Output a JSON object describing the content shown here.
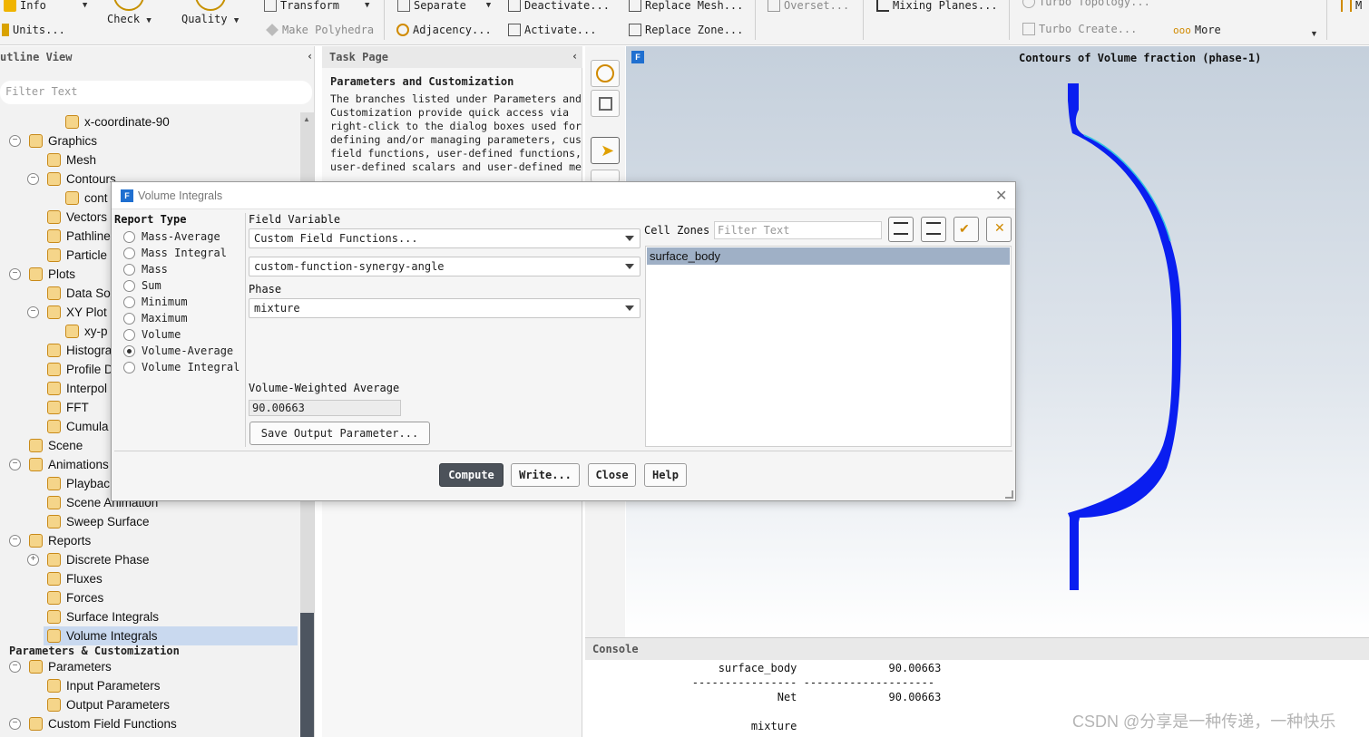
{
  "ribbon": {
    "info": "Info",
    "units": "Units...",
    "check": "Check",
    "quality": "Quality",
    "transform": "Transform",
    "make_polyhedra": "Make Polyhedra",
    "separate": "Separate",
    "adjacency": "Adjacency...",
    "deactivate": "Deactivate...",
    "activate": "Activate...",
    "replace_mesh": "Replace Mesh...",
    "replace_zone": "Replace Zone...",
    "overset": "Overset...",
    "mixing_planes": "Mixing Planes...",
    "turbo_topology": "Turbo Topology...",
    "turbo_create": "Turbo Create...",
    "more": "More",
    "far_right": "M"
  },
  "outline": {
    "title": "utline View",
    "filter_placeholder": "Filter Text",
    "tree": [
      {
        "label": "x-coordinate-90",
        "level": 3,
        "toggle": ""
      },
      {
        "label": "Graphics",
        "level": 1,
        "toggle": "−"
      },
      {
        "label": "Mesh",
        "level": 2,
        "toggle": ""
      },
      {
        "label": "Contours",
        "level": 2,
        "toggle": "−"
      },
      {
        "label": "cont",
        "level": 3,
        "toggle": ""
      },
      {
        "label": "Vectors",
        "level": 2,
        "toggle": ""
      },
      {
        "label": "Pathline",
        "level": 2,
        "toggle": ""
      },
      {
        "label": "Particle",
        "level": 2,
        "toggle": ""
      },
      {
        "label": "Plots",
        "level": 1,
        "toggle": "−"
      },
      {
        "label": "Data So",
        "level": 2,
        "toggle": ""
      },
      {
        "label": "XY Plot",
        "level": 2,
        "toggle": "−"
      },
      {
        "label": "xy-p",
        "level": 3,
        "toggle": ""
      },
      {
        "label": "Histogra",
        "level": 2,
        "toggle": ""
      },
      {
        "label": "Profile D",
        "level": 2,
        "toggle": ""
      },
      {
        "label": "Interpol",
        "level": 2,
        "toggle": ""
      },
      {
        "label": "FFT",
        "level": 2,
        "toggle": ""
      },
      {
        "label": "Cumula",
        "level": 2,
        "toggle": ""
      },
      {
        "label": "Scene",
        "level": 1,
        "toggle": ""
      },
      {
        "label": "Animations",
        "level": 1,
        "toggle": "−"
      },
      {
        "label": "Playbac",
        "level": 2,
        "toggle": ""
      },
      {
        "label": "Scene Animation",
        "level": 2,
        "toggle": ""
      },
      {
        "label": "Sweep Surface",
        "level": 2,
        "toggle": ""
      },
      {
        "label": "Reports",
        "level": 1,
        "toggle": "−"
      },
      {
        "label": "Discrete Phase",
        "level": 2,
        "toggle": "+"
      },
      {
        "label": "Fluxes",
        "level": 2,
        "toggle": ""
      },
      {
        "label": "Forces",
        "level": 2,
        "toggle": ""
      },
      {
        "label": "Surface Integrals",
        "level": 2,
        "toggle": ""
      },
      {
        "label": "Volume Integrals",
        "level": 2,
        "toggle": "",
        "selected": true
      }
    ],
    "section2_title": "Parameters & Customization",
    "tree2": [
      {
        "label": "Parameters",
        "level": 1,
        "toggle": "−"
      },
      {
        "label": "Input Parameters",
        "level": 2,
        "toggle": ""
      },
      {
        "label": "Output Parameters",
        "level": 2,
        "toggle": ""
      },
      {
        "label": "Custom Field Functions",
        "level": 1,
        "toggle": "−"
      }
    ]
  },
  "taskpage": {
    "title": "Task Page",
    "heading": "Parameters and Customization",
    "description_lines": [
      "The branches listed under Parameters and",
      "Customization provide quick access via",
      "right-click to the dialog boxes used for",
      "defining and/or managing parameters, cus",
      "field functions, user-defined functions,",
      "user-defined scalars and user-defined me"
    ]
  },
  "graphics": {
    "title": "Contours of Volume fraction (phase-1)",
    "badge": "F",
    "accent_blue": "#0a1ef0"
  },
  "console": {
    "title": "Console",
    "lines": [
      "            surface_body              90.00663",
      "        ---------------- --------------------",
      "                     Net              90.00663",
      "",
      "                 mixture"
    ]
  },
  "watermark": "CSDN @分享是一种传递，一种快乐",
  "dialog": {
    "title": "Volume Integrals",
    "report_type_label": "Report Type",
    "report_types": [
      "Mass-Average",
      "Mass Integral",
      "Mass",
      "Sum",
      "Minimum",
      "Maximum",
      "Volume",
      "Volume-Average",
      "Volume Integral"
    ],
    "selected_report_type": "Volume-Average",
    "field_variable_label": "Field Variable",
    "field_variable": "Custom Field Functions...",
    "field_function": "custom-function-synergy-angle",
    "phase_label": "Phase",
    "phase": "mixture",
    "result_label": "Volume-Weighted Average",
    "result_value": "90.00663",
    "save_output_button": "Save Output Parameter...",
    "cell_zones_label": "Cell Zones",
    "cell_zones_filter_placeholder": "Filter Text",
    "cell_zones": [
      "surface_body"
    ],
    "buttons": {
      "compute": "Compute",
      "write": "Write...",
      "close": "Close",
      "help": "Help"
    }
  }
}
